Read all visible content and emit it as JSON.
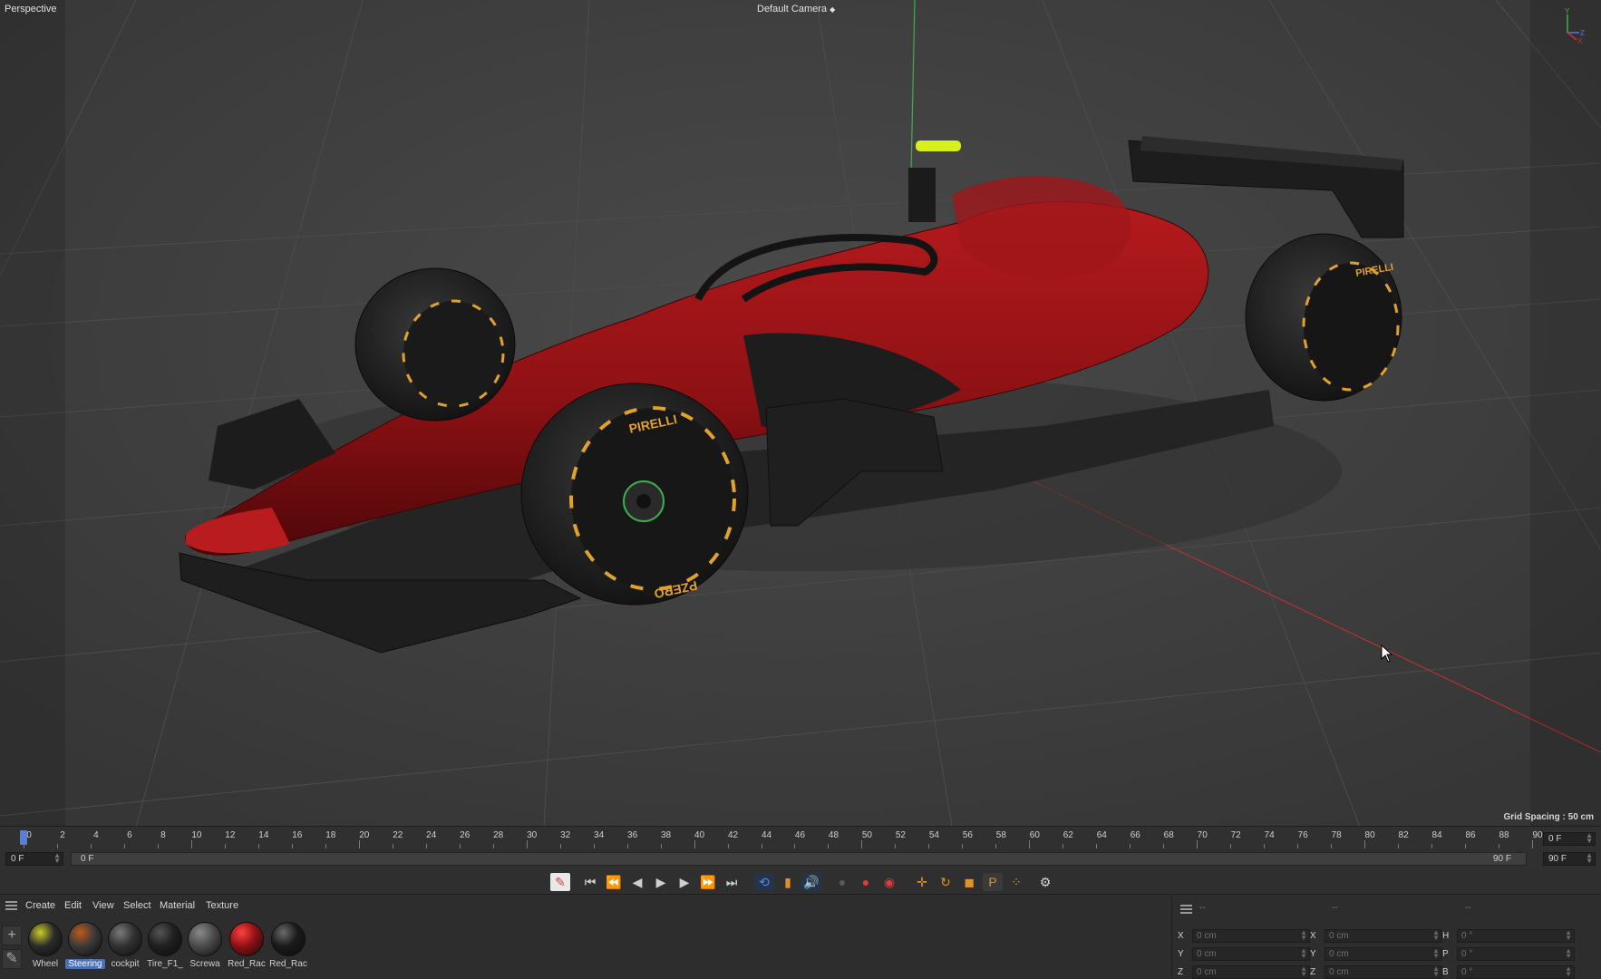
{
  "viewport": {
    "mode_label": "Perspective",
    "camera_label": "Default Camera",
    "grid_spacing": "Grid Spacing : 50 cm",
    "axis_labels": {
      "y": "Y",
      "z": "Z",
      "x": "X"
    },
    "tire_brand": "PIRELLI",
    "tire_model": "PZERO",
    "colors": {
      "body": "#8e1114",
      "tire": "#1b1b1b",
      "tire_marking": "#e2a22a",
      "axis_x": "#c9302c",
      "axis_y": "#3fae4c",
      "halo_accent": "#d6ef1f"
    }
  },
  "timeline": {
    "ticks": [
      "0",
      "2",
      "4",
      "6",
      "8",
      "10",
      "12",
      "14",
      "16",
      "18",
      "20",
      "22",
      "24",
      "26",
      "28",
      "30",
      "32",
      "34",
      "36",
      "38",
      "40",
      "42",
      "44",
      "46",
      "48",
      "50",
      "52",
      "54",
      "56",
      "58",
      "60",
      "62",
      "64",
      "66",
      "68",
      "70",
      "72",
      "74",
      "76",
      "78",
      "80",
      "82",
      "84",
      "86",
      "88",
      "90"
    ],
    "current_frame": "0 F",
    "start_frame": "0 F",
    "range_start": "0 F",
    "range_end": "90 F",
    "end_frame": "90 F",
    "max_frame_right": "90 F"
  },
  "transport": {
    "buttons": [
      {
        "name": "keyframe-mode-icon",
        "glyph": "✎"
      },
      {
        "name": "go-to-start-icon",
        "glyph": "⏮"
      },
      {
        "name": "previous-key-icon",
        "glyph": "⏪"
      },
      {
        "name": "previous-frame-icon",
        "glyph": "◀"
      },
      {
        "name": "play-forward-icon",
        "glyph": "▶"
      },
      {
        "name": "next-frame-icon",
        "glyph": "▶"
      },
      {
        "name": "next-key-icon",
        "glyph": "⏩"
      },
      {
        "name": "go-to-end-icon",
        "glyph": "⏭"
      },
      {
        "name": "loop-icon",
        "glyph": "⟲"
      },
      {
        "name": "animation-layer-icon",
        "glyph": "▮"
      },
      {
        "name": "sound-icon",
        "glyph": "🔊"
      },
      {
        "name": "record-disabled-icon",
        "glyph": "●"
      },
      {
        "name": "record-active-icon",
        "glyph": "●"
      },
      {
        "name": "autokey-icon",
        "glyph": "◉"
      },
      {
        "name": "key-position-icon",
        "glyph": "✛"
      },
      {
        "name": "key-rotation-icon",
        "glyph": "↻"
      },
      {
        "name": "key-scale-icon",
        "glyph": "◼"
      },
      {
        "name": "key-parameter-icon",
        "glyph": "P"
      },
      {
        "name": "key-pla-icon",
        "glyph": "⁘"
      },
      {
        "name": "scheme-icon",
        "glyph": "⚙"
      }
    ]
  },
  "material_manager": {
    "menu": [
      "Create",
      "Edit",
      "View",
      "Select",
      "Material",
      "Texture"
    ],
    "materials": [
      {
        "label": "Wheel",
        "selected": false,
        "color": "#2a2a2a",
        "accent": "#c9cc2a"
      },
      {
        "label": "Steering",
        "selected": true,
        "color": "#3a3a3a",
        "accent": "#c05a1a"
      },
      {
        "label": "cockpit",
        "selected": false,
        "color": "#313131",
        "accent": "#7a7a7a"
      },
      {
        "label": "Tire_F1_",
        "selected": false,
        "color": "#1f1f1f",
        "accent": "#555555"
      },
      {
        "label": "Screwa",
        "selected": false,
        "color": "#4a4a4a",
        "accent": "#8a8a8a"
      },
      {
        "label": "Red_Rac",
        "selected": false,
        "color": "#8e1114",
        "accent": "#ff4040"
      },
      {
        "label": "Red_Rac",
        "selected": false,
        "color": "#1a1a1a",
        "accent": "#6a6a6a"
      }
    ]
  },
  "coordinates": {
    "header_dashes": [
      "--",
      "--",
      "--"
    ],
    "position": [
      {
        "axis": "X",
        "value": "0 cm"
      },
      {
        "axis": "Y",
        "value": "0 cm"
      },
      {
        "axis": "Z",
        "value": "0 cm"
      }
    ],
    "size": [
      {
        "axis": "X",
        "value": "0 cm"
      },
      {
        "axis": "Y",
        "value": "0 cm"
      },
      {
        "axis": "Z",
        "value": "0 cm"
      }
    ],
    "rotation": [
      {
        "axis": "H",
        "value": "0 °"
      },
      {
        "axis": "P",
        "value": "0 °"
      },
      {
        "axis": "B",
        "value": "0 °"
      }
    ]
  }
}
